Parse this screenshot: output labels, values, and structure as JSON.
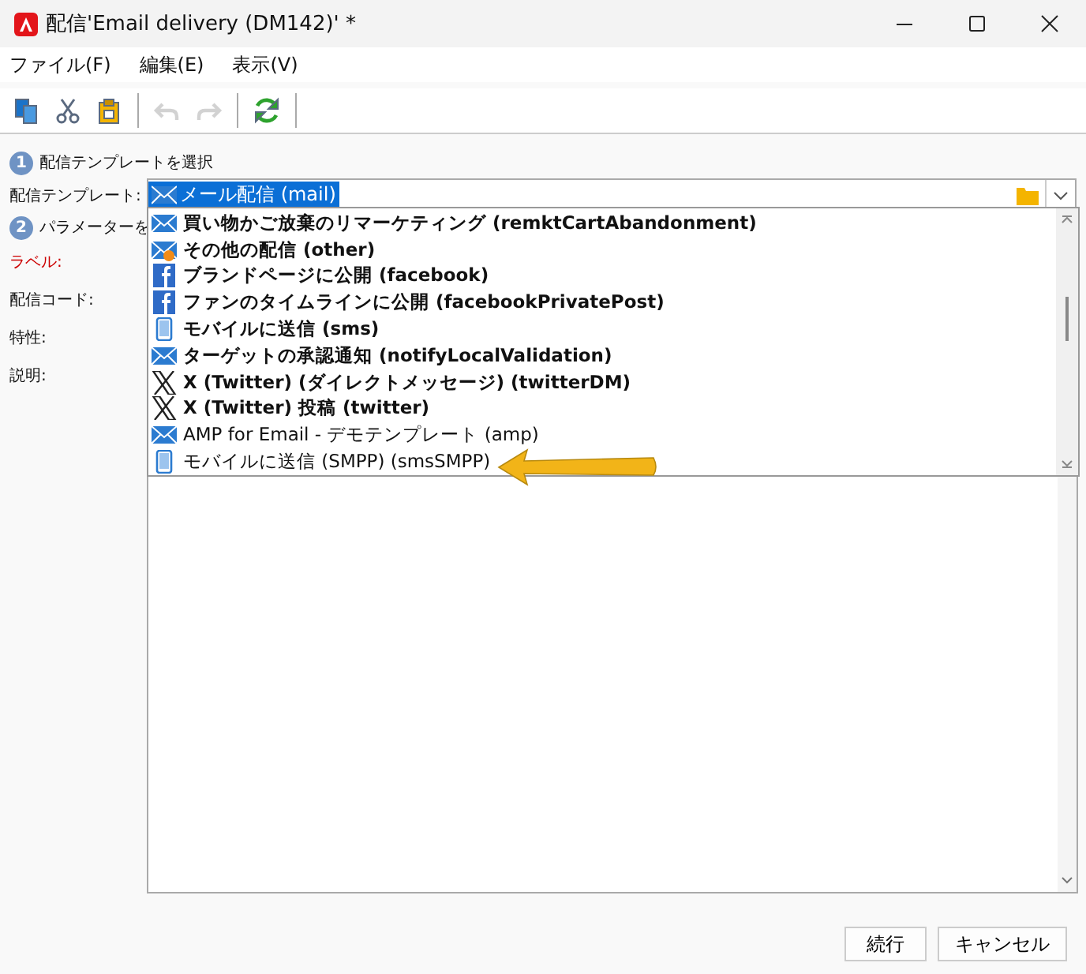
{
  "window": {
    "title": "配信'Email delivery (DM142)' *"
  },
  "menu": [
    {
      "label": "ファイル(F)"
    },
    {
      "label": "編集(E)"
    },
    {
      "label": "表示(V)"
    }
  ],
  "toolbar": [
    {
      "kind": "copy",
      "disabled": false
    },
    {
      "kind": "cut",
      "disabled": false
    },
    {
      "kind": "paste",
      "disabled": false
    },
    {
      "kind": "sep"
    },
    {
      "kind": "undo",
      "disabled": true
    },
    {
      "kind": "redo",
      "disabled": true
    },
    {
      "kind": "sep"
    },
    {
      "kind": "refresh",
      "disabled": false
    },
    {
      "kind": "sep"
    }
  ],
  "steps": [
    {
      "number": "1",
      "title": "配信テンプレートを選択"
    },
    {
      "number": "2",
      "title": "パラメーターを"
    }
  ],
  "template_field": {
    "label": "配信テンプレート:",
    "value": "メール配信 (mail)"
  },
  "fields": [
    {
      "label": "ラベル:",
      "required": true
    },
    {
      "label": "配信コード:",
      "required": false
    },
    {
      "label": "特性:",
      "required": false
    },
    {
      "label": "説明:",
      "required": false
    }
  ],
  "dropdown": [
    {
      "kind": "mail",
      "text": "買い物かご放棄のリマーケティング (remktCartAbandonment)",
      "bold": true
    },
    {
      "kind": "mail-other",
      "text": "その他の配信 (other)",
      "bold": true
    },
    {
      "kind": "facebook",
      "text": "ブランドページに公開 (facebook)",
      "bold": true
    },
    {
      "kind": "facebook",
      "text": "ファンのタイムラインに公開 (facebookPrivatePost)",
      "bold": true
    },
    {
      "kind": "mobile",
      "text": "モバイルに送信 (sms)",
      "bold": true
    },
    {
      "kind": "mail",
      "text": "ターゲットの承認通知 (notifyLocalValidation)",
      "bold": true
    },
    {
      "kind": "x",
      "text": "X (Twitter) (ダイレクトメッセージ) (twitterDM)",
      "bold": true
    },
    {
      "kind": "x",
      "text": "X (Twitter) 投稿 (twitter)",
      "bold": true
    },
    {
      "kind": "mail",
      "text": "AMP for Email - デモテンプレート (amp)",
      "bold": false
    },
    {
      "kind": "mobile",
      "text": "モバイルに送信 (SMPP) (smsSMPP)",
      "bold": false
    }
  ],
  "buttons": [
    {
      "label": "続行"
    },
    {
      "label": "キャンセル"
    }
  ]
}
